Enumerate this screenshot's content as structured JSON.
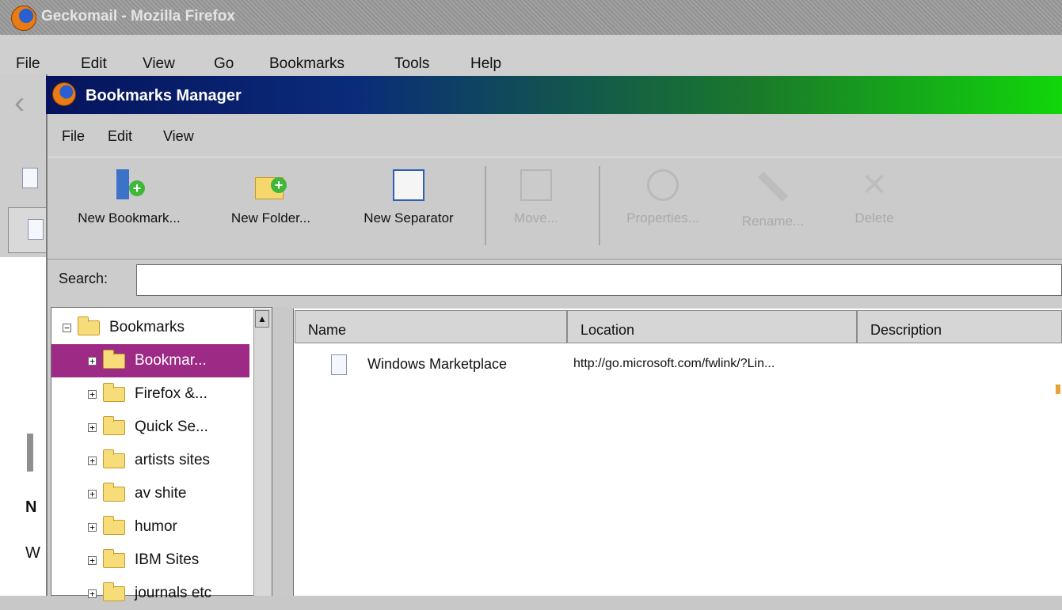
{
  "outer_window": {
    "title": "Geckomail - Mozilla Firefox",
    "menu": [
      "File",
      "Edit",
      "View",
      "Go",
      "Bookmarks",
      "Tools",
      "Help"
    ],
    "left_glimpse": [
      "N",
      "W"
    ]
  },
  "bm_window": {
    "title": "Bookmarks Manager",
    "menu": [
      "File",
      "Edit",
      "View"
    ],
    "toolbar": [
      {
        "label": "New Bookmark...",
        "icon": "new-bookmark-icon",
        "enabled": true
      },
      {
        "label": "New Folder...",
        "icon": "new-folder-icon",
        "enabled": true
      },
      {
        "label": "New Separator",
        "icon": "new-separator-icon",
        "enabled": true
      },
      {
        "label": "Move...",
        "icon": "move-icon",
        "enabled": false
      },
      {
        "label": "Properties...",
        "icon": "properties-icon",
        "enabled": false
      },
      {
        "label": "Rename...",
        "icon": "rename-icon",
        "enabled": false
      },
      {
        "label": "Delete",
        "icon": "delete-icon",
        "enabled": false
      }
    ],
    "search": {
      "label": "Search:",
      "value": ""
    },
    "tree": [
      {
        "label": "Bookmarks",
        "expander": "−",
        "selected": false,
        "level": 0
      },
      {
        "label": "Bookmar...",
        "expander": "+",
        "selected": true,
        "level": 1
      },
      {
        "label": "Firefox &...",
        "expander": "+",
        "selected": false,
        "level": 1
      },
      {
        "label": "Quick Se...",
        "expander": "+",
        "selected": false,
        "level": 1
      },
      {
        "label": "artists sites",
        "expander": "+",
        "selected": false,
        "level": 1
      },
      {
        "label": "av shite",
        "expander": "+",
        "selected": false,
        "level": 1
      },
      {
        "label": "humor",
        "expander": "+",
        "selected": false,
        "level": 1
      },
      {
        "label": "IBM Sites",
        "expander": "+",
        "selected": false,
        "level": 1
      },
      {
        "label": "journals etc",
        "expander": "+",
        "selected": false,
        "level": 1
      }
    ],
    "columns": [
      "Name",
      "Location",
      "Description"
    ],
    "rows": [
      {
        "name": "Windows Marketplace",
        "location": "http://go.microsoft.com/fwlink/?Lin...",
        "description": ""
      }
    ]
  },
  "colors": {
    "selection": "#9d2a84",
    "title_gradient_start": "#06135c",
    "title_gradient_end": "#11d60a"
  }
}
